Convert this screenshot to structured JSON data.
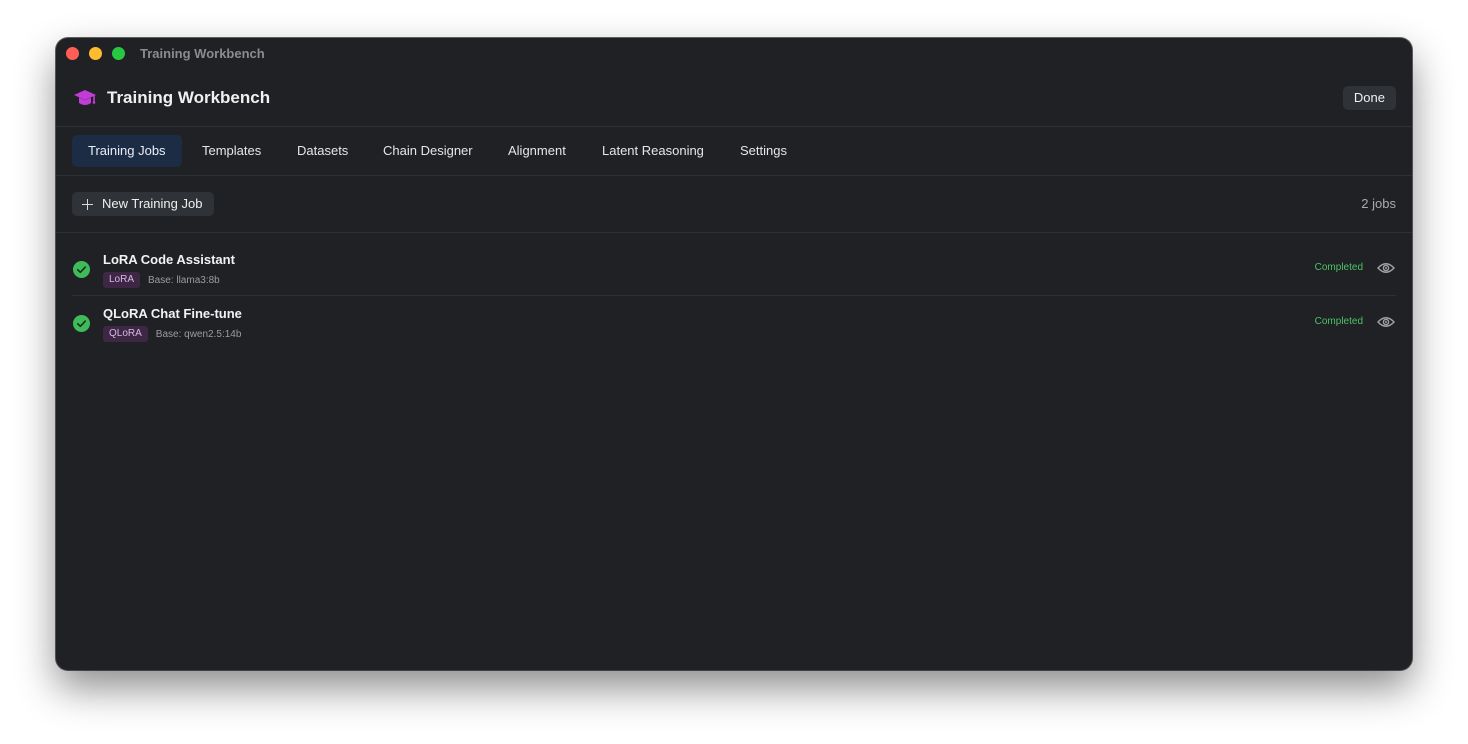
{
  "window": {
    "title": "Training Workbench"
  },
  "header": {
    "app_title": "Training Workbench",
    "app_icon": "graduation-cap-icon",
    "done_label": "Done"
  },
  "tabs": [
    {
      "label": "Training Jobs",
      "active": true
    },
    {
      "label": "Templates",
      "active": false
    },
    {
      "label": "Datasets",
      "active": false
    },
    {
      "label": "Chain Designer",
      "active": false
    },
    {
      "label": "Alignment",
      "active": false
    },
    {
      "label": "Latent Reasoning",
      "active": false
    },
    {
      "label": "Settings",
      "active": false
    }
  ],
  "toolbar": {
    "new_job_label": "New Training Job",
    "job_count": "2 jobs"
  },
  "jobs": [
    {
      "name": "LoRA Code Assistant",
      "method": "LoRA",
      "base": "Base: llama3:8b",
      "status": "Completed"
    },
    {
      "name": "QLoRA Chat Fine-tune",
      "method": "QLoRA",
      "base": "Base: qwen2.5:14b",
      "status": "Completed"
    }
  ],
  "colors": {
    "accent_purple": "#c23cd8",
    "status_green": "#4cc366",
    "active_tab_bg": "#1b2c44",
    "window_bg": "#1f2124"
  }
}
